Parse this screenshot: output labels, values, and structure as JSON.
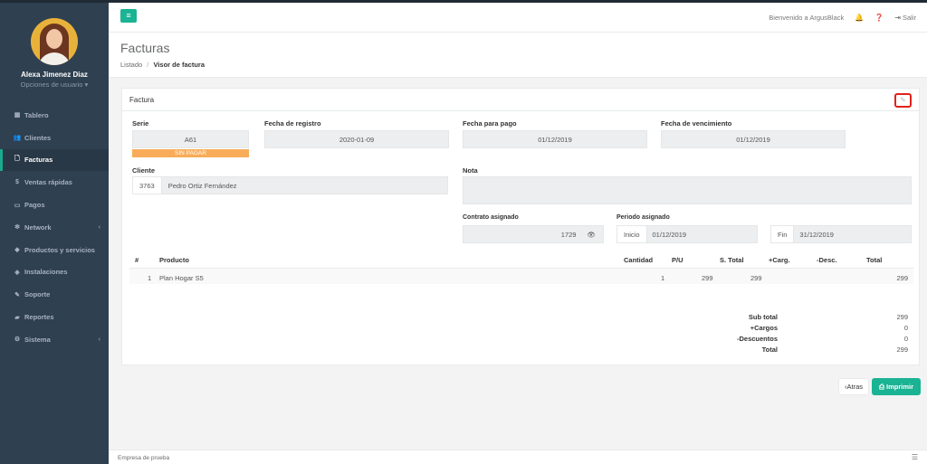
{
  "sidebar": {
    "user_name": "Alexa Jimenez Diaz",
    "user_options": "Opciones de usuario ▾",
    "items": [
      {
        "icon": "dashboard-icon",
        "glyph": "▦",
        "label": "Tablero"
      },
      {
        "icon": "users-icon",
        "glyph": "👥",
        "label": "Clientes"
      },
      {
        "icon": "file-icon",
        "glyph": "🗋",
        "label": "Facturas"
      },
      {
        "icon": "dollar-icon",
        "glyph": "$",
        "label": "Ventas rápidas"
      },
      {
        "icon": "money-icon",
        "glyph": "▭",
        "label": "Pagos"
      },
      {
        "icon": "network-icon",
        "glyph": "✻",
        "label": "Network"
      },
      {
        "icon": "tag-icon",
        "glyph": "◆",
        "label": "Productos y servicios"
      },
      {
        "icon": "rocket-icon",
        "glyph": "◈",
        "label": "Instalaciones"
      },
      {
        "icon": "wrench-icon",
        "glyph": "✎",
        "label": "Soporte"
      },
      {
        "icon": "book-icon",
        "glyph": "▰",
        "label": "Reportes"
      },
      {
        "icon": "cogs-icon",
        "glyph": "⚙",
        "label": "Sistema"
      }
    ]
  },
  "topbar": {
    "welcome": "Bienvenido a ArgusBlack",
    "logout": "Salir"
  },
  "heading": {
    "title": "Facturas",
    "breadcrumb_root": "Listado",
    "breadcrumb_sep": "/",
    "breadcrumb_current": "Visor de factura"
  },
  "invoice": {
    "panel_title": "Factura",
    "serie_label": "Serie",
    "serie_value": "A61",
    "status_badge": "SIN PAGAR",
    "registro_label": "Fecha de registro",
    "registro_value": "2020-01-09",
    "pago_label": "Fecha para pago",
    "pago_value": "01/12/2019",
    "vencimiento_label": "Fecha de vencimiento",
    "vencimiento_value": "01/12/2019",
    "cliente_label": "Cliente",
    "cliente_id": "3763",
    "cliente_name": "Pedro Ortiz Fernández",
    "nota_label": "Nota",
    "nota_value": "",
    "contrato_label": "Contrato asignado",
    "contrato_value": "1729",
    "periodo_label": "Periodo asignado",
    "inicio_label": "Inicio",
    "inicio_value": "01/12/2019",
    "fin_label": "Fin",
    "fin_value": "31/12/2019"
  },
  "table": {
    "headers": [
      "#",
      "Producto",
      "Cantidad",
      "P/U",
      "S. Total",
      "+Carg.",
      "-Desc.",
      "Total"
    ],
    "rows": [
      {
        "num": "1",
        "producto": "Plan Hogar S5",
        "cantidad": "",
        "pu": "1",
        "stotal": "299",
        "carg": "299",
        "desc": "",
        "total": "299"
      }
    ]
  },
  "totals": {
    "subtotal_label": "Sub total",
    "subtotal_value": "299",
    "cargos_label": "+Cargos",
    "cargos_value": "0",
    "descuentos_label": "-Descuentos",
    "descuentos_value": "0",
    "total_label": "Total",
    "total_value": "299"
  },
  "actions": {
    "back_label": "Atras",
    "print_label": "Imprimir"
  },
  "footer": {
    "company": "Empresa de prueba"
  },
  "colors": {
    "accent": "#1ab394",
    "sidebar": "#2f4050",
    "badge": "#f8ac59",
    "highlight": "#e0221a"
  }
}
